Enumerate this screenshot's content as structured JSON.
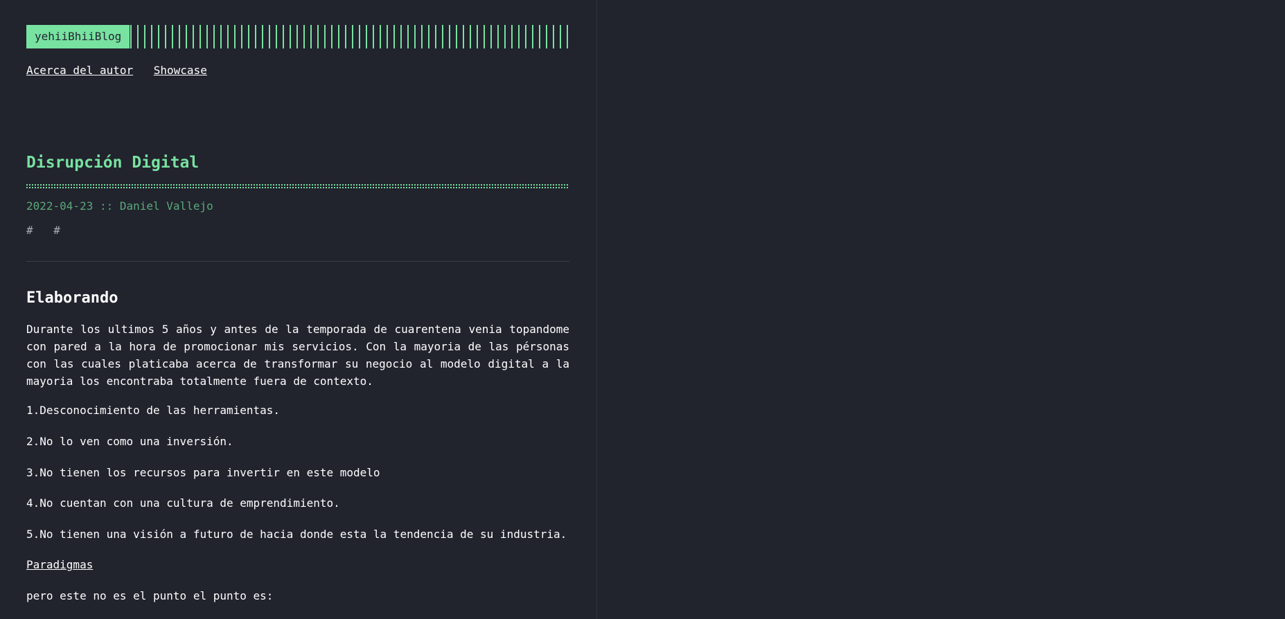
{
  "site": {
    "logo_text": "yehiiBhiiBlog",
    "accent_color": "#78e2a0",
    "background_color": "#21232d"
  },
  "nav": {
    "items": [
      "Acerca del autor",
      "Showcase"
    ]
  },
  "post": {
    "title": "Disrupción Digital",
    "meta": "2022-04-23 :: Daniel Vallejo",
    "tags": [
      "#",
      "#"
    ],
    "section_title": "Elaborando",
    "intro": "Durante los ultimos 5 años y antes de la temporada de cuarentena venia topandome con pared a la hora de promocionar mis servicios. Con la mayoria de las pérsonas con las cuales platicaba acerca de transformar su negocio al modelo digital a la mayoria los encontraba totalmente fuera de contexto.",
    "list": [
      "1.Desconocimiento de las herramientas.",
      "2.No lo ven como una inversión.",
      "3.No tienen los recursos para invertir en este modelo",
      "4.No cuentan con una cultura de emprendimiento.",
      "5.No tienen una visión a futuro de hacia donde esta la tendencia de su industria."
    ],
    "paradigm_link": "Paradigmas",
    "closing": "pero este no es el punto el punto es:"
  }
}
